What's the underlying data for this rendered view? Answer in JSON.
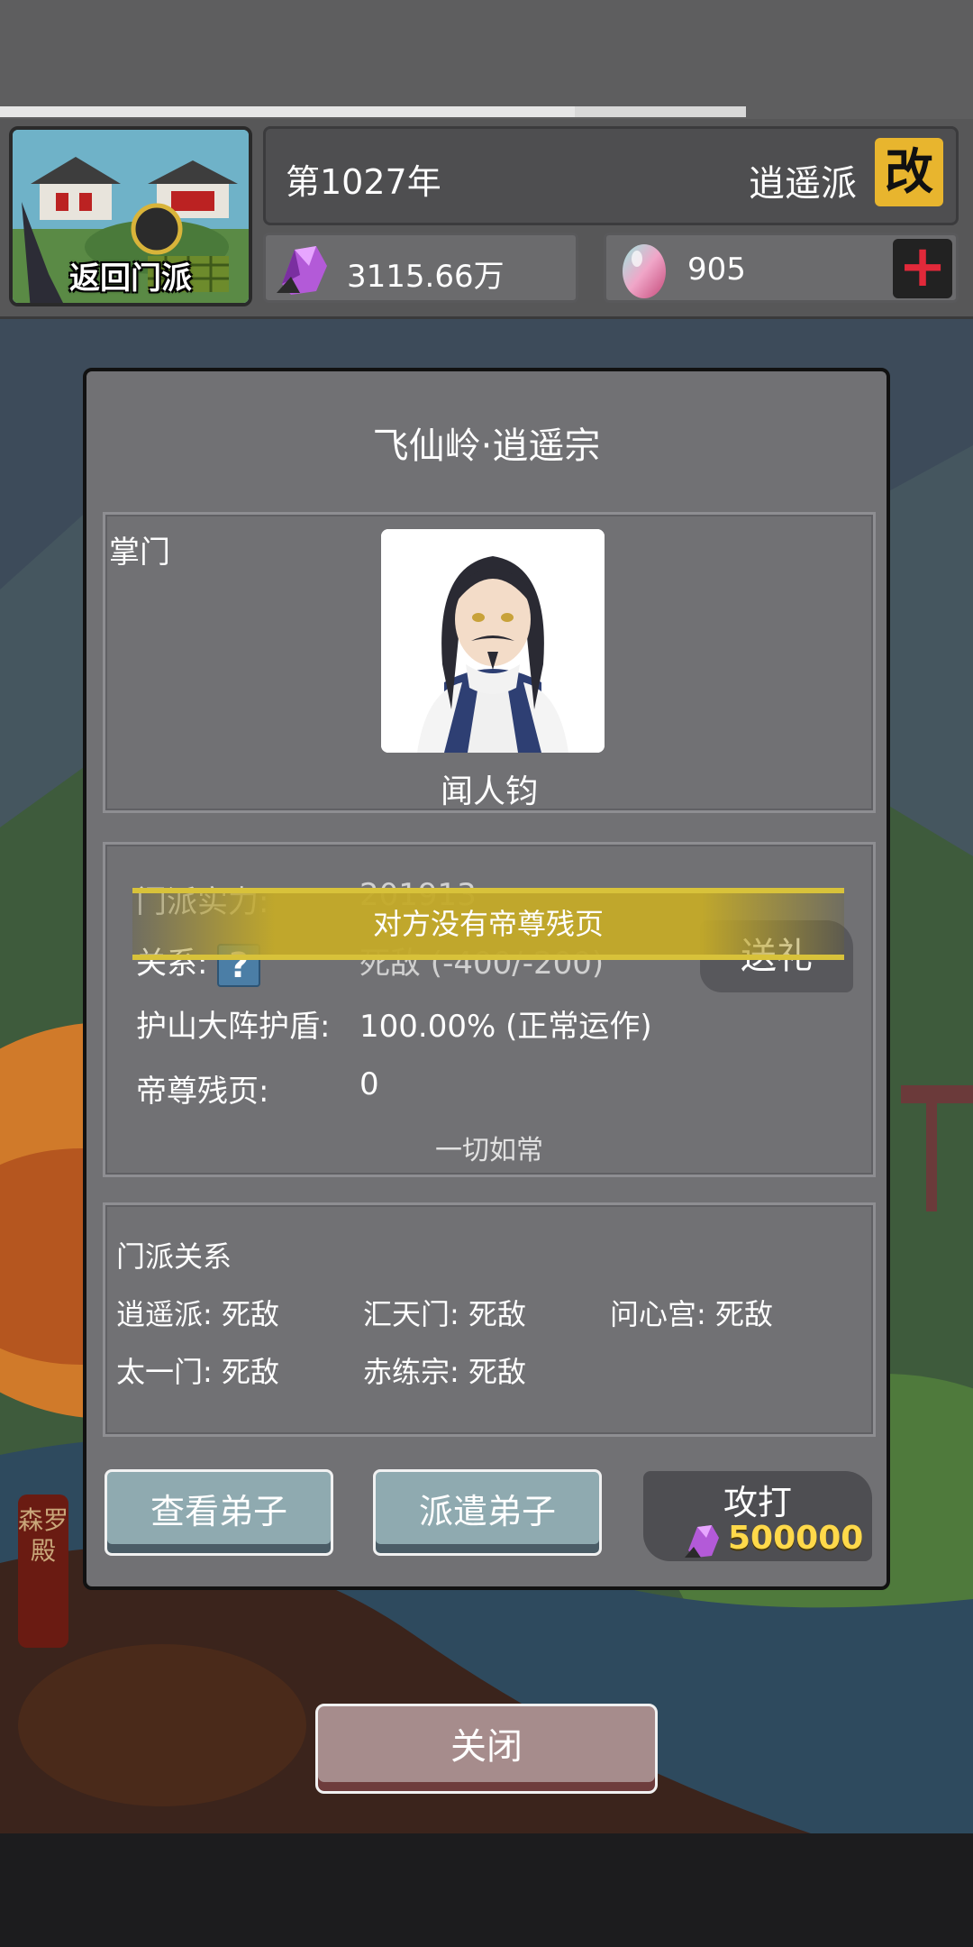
{
  "header": {
    "progress": 0.77,
    "return_label": "返回门派",
    "year": "第1027年",
    "sect_name": "逍遥派",
    "rename_label": "改",
    "spirit_stones": "3115.66万",
    "spirit_eggs": "905",
    "plus_label": "+"
  },
  "dialog": {
    "title": "飞仙岭·逍遥宗",
    "leader_label": "掌门",
    "leader_name": "闻人钧",
    "stats": {
      "power_label": "门派实力:",
      "power_value": "201913",
      "relation_label": "关系:",
      "relation_value": "死敌 (-400/-200)",
      "shield_label": "护山大阵护盾:",
      "shield_value": "100.00% (正常运作)",
      "pages_label": "帝尊残页:",
      "pages_value": "0",
      "status_note": "一切如常",
      "gift_label": "送礼",
      "toast": "对方没有帝尊残页"
    },
    "relations": {
      "title": "门派关系",
      "items": [
        "逍遥派: 死敌",
        "汇天门: 死敌",
        "问心宫: 死敌",
        "太一门: 死敌",
        "赤练宗: 死敌"
      ]
    },
    "buttons": {
      "view_disciples": "查看弟子",
      "dispatch_disciples": "派遣弟子",
      "attack": "攻打",
      "attack_cost": "500000"
    }
  },
  "side_tag": "森罗殿",
  "close_label": "关闭",
  "colors": {
    "accent_gold": "#e8b52e",
    "cost_yellow": "#ffd94a",
    "dialog_bg": "#717174",
    "plus_red": "#e2293a"
  }
}
